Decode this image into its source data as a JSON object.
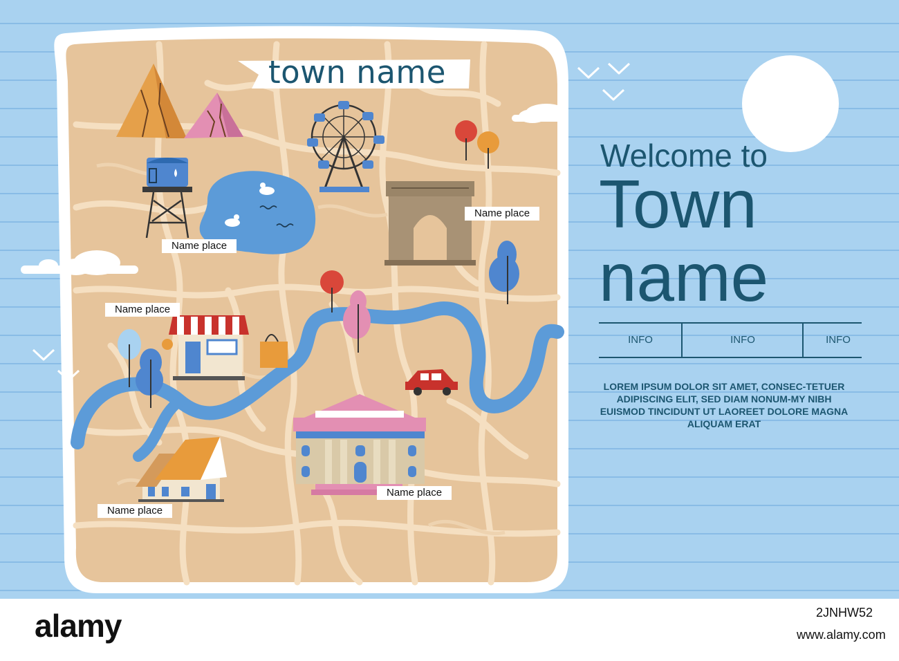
{
  "map": {
    "title": "town name",
    "labels": {
      "water_tower": "Name place",
      "arch": "Name place",
      "shop": "Name place",
      "house": "Name place",
      "museum": "Name place"
    }
  },
  "welcome": {
    "line1": "Welcome to",
    "line2": "Town",
    "line3": "name"
  },
  "info": [
    "INFO",
    "INFO",
    "INFO"
  ],
  "lorem": "LOREM IPSUM DOLOR SIT AMET, CONSEC-TETUER ADIPISCING ELIT, SED DIAM NONUM-MY NIBH EUISMOD TINCIDUNT UT LAOREET DOLORE MAGNA ALIQUAM ERAT",
  "stock": {
    "brand": "alamy",
    "image_id": "2JNHW52",
    "url": "www.alamy.com"
  },
  "colors": {
    "sky": "#a9d2f0",
    "map_land": "#e6c49b",
    "river": "#5c9bd8",
    "title_blue": "#1c5670"
  },
  "icons": [
    "mountains",
    "water-tower",
    "lake",
    "ferris-wheel",
    "arch",
    "shop",
    "shopping-bag",
    "car",
    "house",
    "museum",
    "trees",
    "sun",
    "clouds",
    "birds"
  ]
}
